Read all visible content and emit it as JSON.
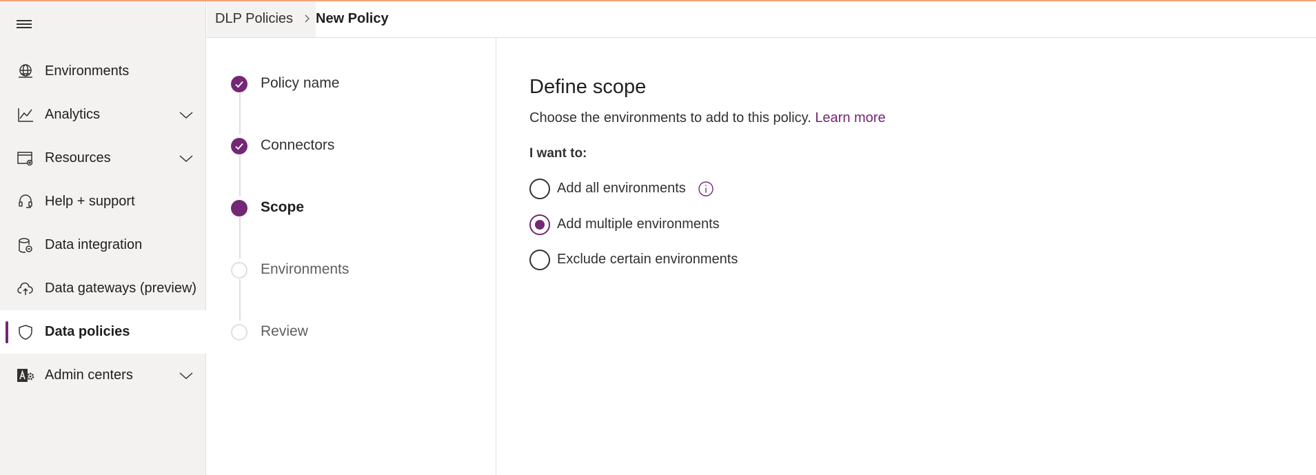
{
  "colors": {
    "accent": "#742774",
    "top_line": "#f4a278",
    "sidebar_bg": "#f3f2f1"
  },
  "sidebar": {
    "menu_icon": "hamburger-icon",
    "items": [
      {
        "label": "Environments",
        "icon": "globe-icon",
        "expandable": false
      },
      {
        "label": "Analytics",
        "icon": "chart-icon",
        "expandable": true
      },
      {
        "label": "Resources",
        "icon": "resources-icon",
        "expandable": true
      },
      {
        "label": "Help + support",
        "icon": "headset-icon",
        "expandable": false
      },
      {
        "label": "Data integration",
        "icon": "database-icon",
        "expandable": false
      },
      {
        "label": "Data gateways (preview)",
        "icon": "cloud-upload-icon",
        "expandable": false
      },
      {
        "label": "Data policies",
        "icon": "shield-icon",
        "expandable": false,
        "active": true
      },
      {
        "label": "Admin centers",
        "icon": "admin-centers-icon",
        "expandable": true
      }
    ]
  },
  "breadcrumb": {
    "parent": "DLP Policies",
    "current": "New Policy"
  },
  "stepper": {
    "steps": [
      {
        "label": "Policy name",
        "state": "done"
      },
      {
        "label": "Connectors",
        "state": "done"
      },
      {
        "label": "Scope",
        "state": "current"
      },
      {
        "label": "Environments",
        "state": "pending"
      },
      {
        "label": "Review",
        "state": "pending"
      }
    ]
  },
  "main": {
    "title": "Define scope",
    "description": "Choose the environments to add to this policy.",
    "learn_more": "Learn more",
    "question": "I want to:",
    "options": [
      {
        "label": "Add all environments",
        "checked": false,
        "info": true
      },
      {
        "label": "Add multiple environments",
        "checked": true
      },
      {
        "label": "Exclude certain environments",
        "checked": false
      }
    ]
  }
}
